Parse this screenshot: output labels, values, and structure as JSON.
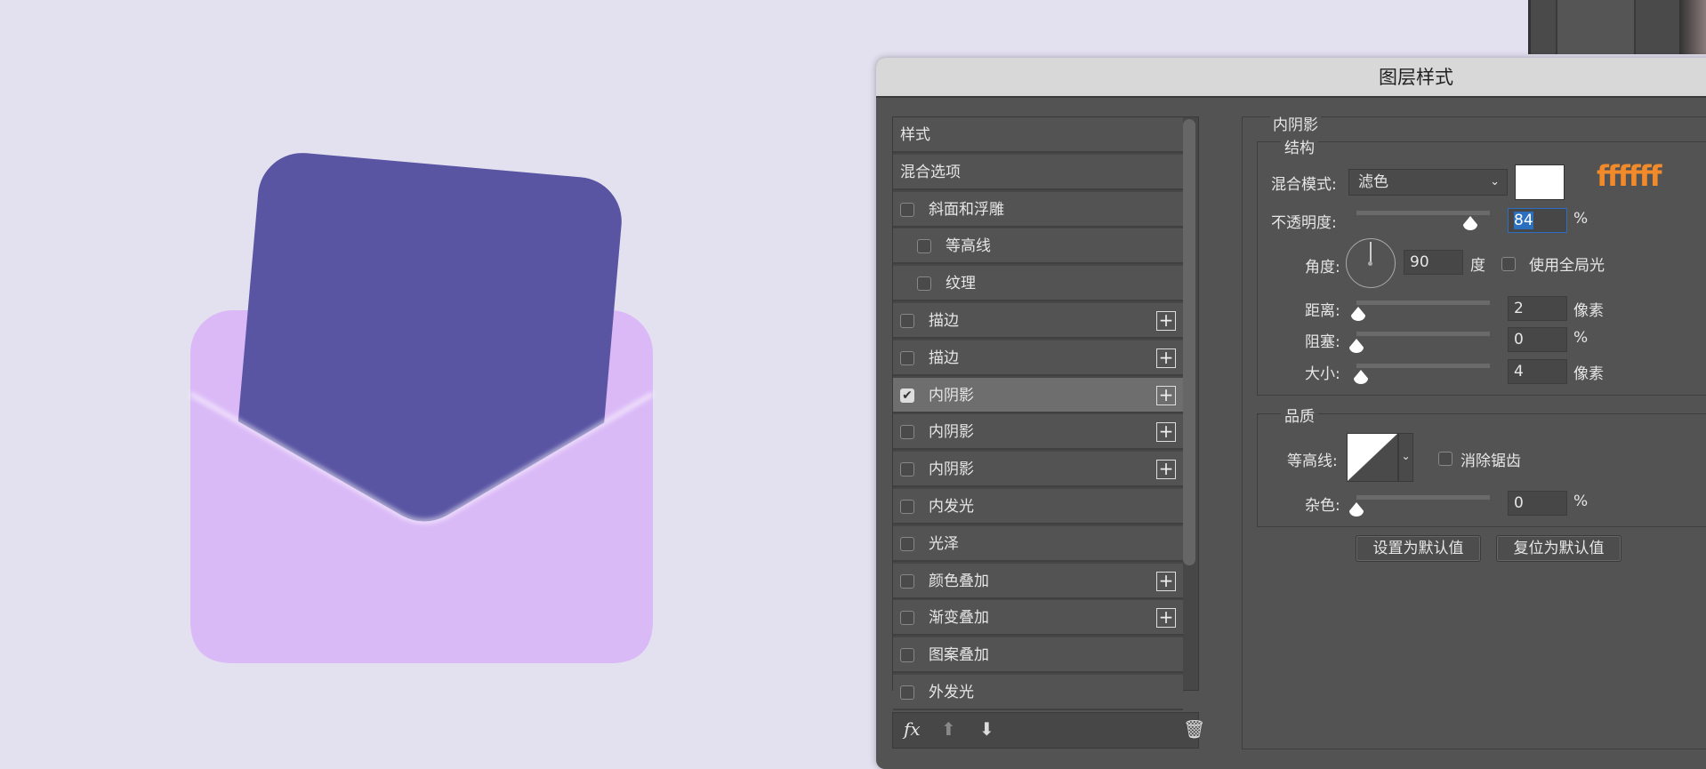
{
  "dialog": {
    "title": "图层样式"
  },
  "styles_list": [
    {
      "label": "样式",
      "checkbox": false,
      "indent": 0,
      "plus": false
    },
    {
      "label": "混合选项",
      "checkbox": false,
      "indent": 0,
      "plus": false
    },
    {
      "label": "斜面和浮雕",
      "checkbox": true,
      "checked": false,
      "indent": 0,
      "plus": false
    },
    {
      "label": "等高线",
      "checkbox": true,
      "checked": false,
      "indent": 1,
      "plus": false
    },
    {
      "label": "纹理",
      "checkbox": true,
      "checked": false,
      "indent": 1,
      "plus": false
    },
    {
      "label": "描边",
      "checkbox": true,
      "checked": false,
      "indent": 0,
      "plus": true
    },
    {
      "label": "描边",
      "checkbox": true,
      "checked": false,
      "indent": 0,
      "plus": true
    },
    {
      "label": "内阴影",
      "checkbox": true,
      "checked": true,
      "indent": 0,
      "plus": true,
      "selected": true
    },
    {
      "label": "内阴影",
      "checkbox": true,
      "checked": false,
      "indent": 0,
      "plus": true
    },
    {
      "label": "内阴影",
      "checkbox": true,
      "checked": false,
      "indent": 0,
      "plus": true
    },
    {
      "label": "内发光",
      "checkbox": true,
      "checked": false,
      "indent": 0,
      "plus": false
    },
    {
      "label": "光泽",
      "checkbox": true,
      "checked": false,
      "indent": 0,
      "plus": false
    },
    {
      "label": "颜色叠加",
      "checkbox": true,
      "checked": false,
      "indent": 0,
      "plus": true
    },
    {
      "label": "渐变叠加",
      "checkbox": true,
      "checked": false,
      "indent": 0,
      "plus": true
    },
    {
      "label": "图案叠加",
      "checkbox": true,
      "checked": false,
      "indent": 0,
      "plus": false
    },
    {
      "label": "外发光",
      "checkbox": true,
      "checked": false,
      "indent": 0,
      "plus": false
    }
  ],
  "bottom_bar": {
    "fx": "fx",
    "icons": [
      "fx-icon",
      "arrow-up-icon",
      "arrow-down-icon",
      "trash-icon"
    ]
  },
  "panel": {
    "section_title": "内阴影",
    "structure": {
      "title": "结构",
      "blend_mode_label": "混合模式:",
      "blend_mode": "滤色",
      "color": "#ffffff",
      "color_annotation": "ffffff",
      "opacity_label": "不透明度:",
      "opacity": "84",
      "opacity_unit": "%",
      "angle_label": "角度:",
      "angle": "90",
      "angle_unit": "度",
      "global_light_label": "使用全局光",
      "global_light": false,
      "distance_label": "距离:",
      "distance": "2",
      "distance_unit": "像素",
      "choke_label": "阻塞:",
      "choke": "0",
      "choke_unit": "%",
      "size_label": "大小:",
      "size": "4",
      "size_unit": "像素"
    },
    "quality": {
      "title": "品质",
      "contour_label": "等高线:",
      "antialias_label": "消除锯齿",
      "antialias": false,
      "noise_label": "杂色:",
      "noise": "0",
      "noise_unit": "%"
    },
    "buttons": {
      "set_default": "设置为默认值",
      "reset_default": "复位为默认值"
    }
  },
  "colors": {
    "canvas": "#e3e0f0",
    "envelope": "#dbb9f7",
    "card": "#5a55a3",
    "annotation": "#f08a2a",
    "dialog": "#535353"
  }
}
